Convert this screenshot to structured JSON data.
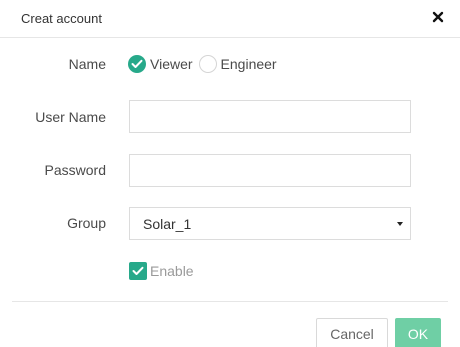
{
  "dialog": {
    "title": "Creat account",
    "close_icon": "close-icon"
  },
  "form": {
    "name": {
      "label": "Name",
      "options": [
        {
          "label": "Viewer",
          "selected": true
        },
        {
          "label": "Engineer",
          "selected": false
        }
      ]
    },
    "username": {
      "label": "User Name",
      "value": "",
      "placeholder": ""
    },
    "password": {
      "label": "Password",
      "value": "",
      "placeholder": ""
    },
    "group": {
      "label": "Group",
      "selected": "Solar_1"
    },
    "enable": {
      "label": "Enable",
      "checked": true
    }
  },
  "footer": {
    "cancel_label": "Cancel",
    "ok_label": "OK"
  },
  "colors": {
    "accent": "#27a98a",
    "ok_button": "#6fcfa5"
  }
}
